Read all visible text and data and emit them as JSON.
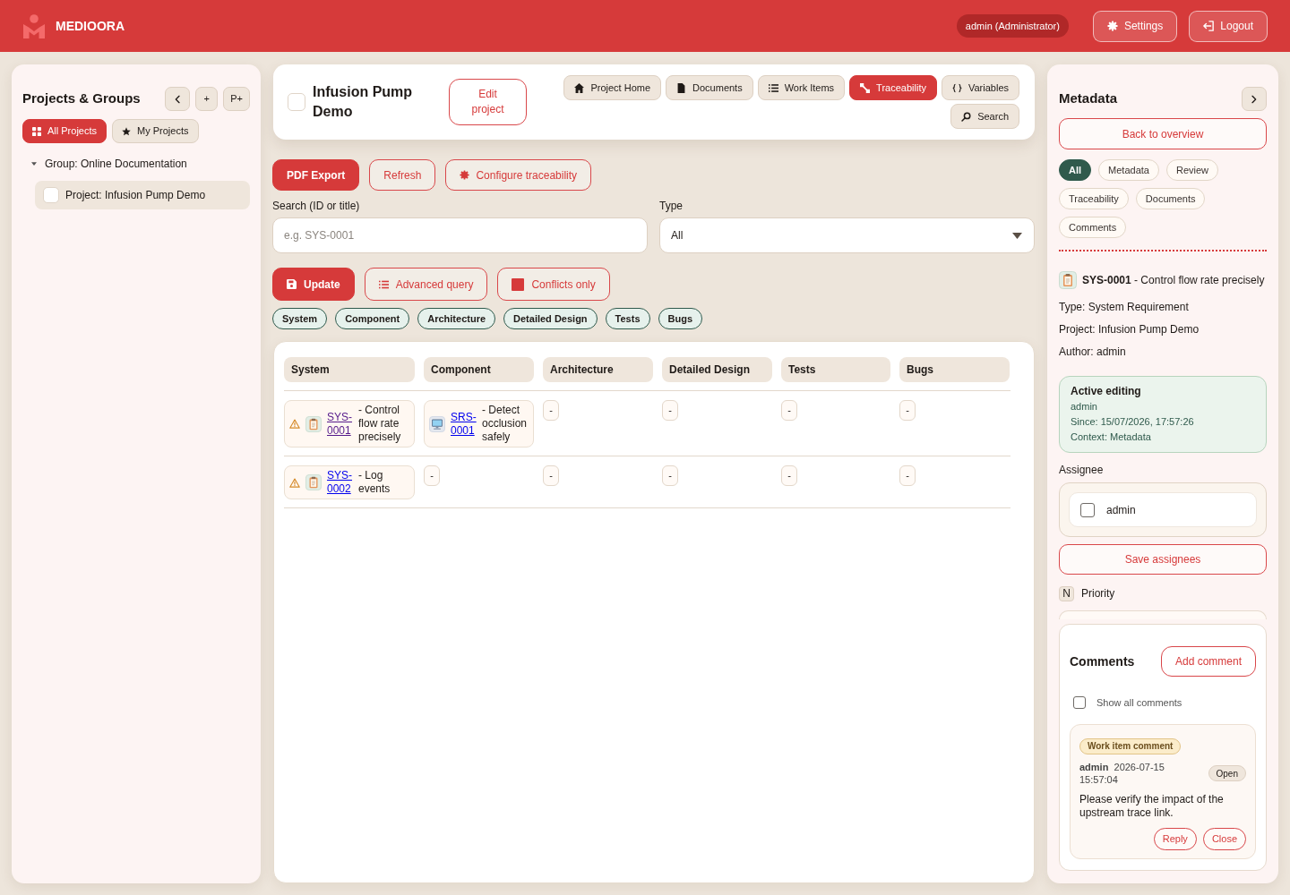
{
  "header": {
    "brand": "MEDIOORA",
    "user": "admin (Administrator)",
    "buttons": [
      "Settings",
      "Logout"
    ]
  },
  "sidebar": {
    "title": "Projects & Groups",
    "tool_buttons": [
      "+",
      "P+"
    ],
    "tabs": [
      {
        "label": "All Projects",
        "selected": true
      },
      {
        "label": "My Projects",
        "selected": false
      }
    ],
    "tree": [
      {
        "label": "Group: Online Documentation",
        "expanded": true,
        "children": [
          {
            "label": "Project: Infusion Pump Demo",
            "selected": true
          }
        ]
      }
    ]
  },
  "project": {
    "title": "Infusion Pump Demo",
    "edit_button": "Edit project",
    "nav": [
      {
        "label": "Project Home",
        "selected": false
      },
      {
        "label": "Documents",
        "selected": false
      },
      {
        "label": "Work Items",
        "selected": false
      },
      {
        "label": "Traceability",
        "selected": true
      },
      {
        "label": "Variables",
        "selected": false
      },
      {
        "label": "Search",
        "selected": false
      }
    ]
  },
  "actions": [
    {
      "label": "PDF Export",
      "kind": "primary"
    },
    {
      "label": "Refresh",
      "kind": "secondary"
    },
    {
      "label": "Configure traceability",
      "kind": "secondary"
    }
  ],
  "filters": {
    "search": {
      "label": "Search (ID or title)",
      "placeholder": "e.g. SYS-0001"
    },
    "type": {
      "label": "Type",
      "value": "All"
    }
  },
  "query_buttons": [
    {
      "label": "Update",
      "kind": "primary"
    },
    {
      "label": "Advanced query",
      "kind": "secondary"
    },
    {
      "label": "Conflicts only",
      "kind": "secondary"
    }
  ],
  "levels": [
    "System",
    "Component",
    "Architecture",
    "Detailed Design",
    "Tests",
    "Bugs"
  ],
  "table": {
    "columns": [
      "System",
      "Component",
      "Architecture",
      "Detailed Design",
      "Tests",
      "Bugs"
    ],
    "rows": [
      {
        "cells": [
          {
            "kind": "item",
            "warning": true,
            "id": "SYS-0001",
            "title": "- Control flow rate precisely",
            "visited": true
          },
          {
            "kind": "item",
            "warning": false,
            "id": "SRS-0001",
            "title": "- Detect occlusion safely",
            "visited": false
          },
          {
            "kind": "empty",
            "text": "-"
          },
          {
            "kind": "empty",
            "text": "-"
          },
          {
            "kind": "empty",
            "text": "-"
          },
          {
            "kind": "empty",
            "text": "-"
          }
        ]
      },
      {
        "cells": [
          {
            "kind": "item",
            "warning": true,
            "id": "SYS-0002",
            "title": "- Log events",
            "visited": false
          },
          {
            "kind": "empty",
            "text": "-"
          },
          {
            "kind": "empty",
            "text": "-"
          },
          {
            "kind": "empty",
            "text": "-"
          },
          {
            "kind": "empty",
            "text": "-"
          },
          {
            "kind": "empty",
            "text": "-"
          }
        ]
      }
    ]
  },
  "metadata_panel": {
    "title": "Metadata",
    "back_button": "Back to overview",
    "filters": [
      {
        "label": "All",
        "selected": true
      },
      {
        "label": "Metadata",
        "selected": false
      },
      {
        "label": "Review",
        "selected": false
      },
      {
        "label": "Traceability",
        "selected": false
      },
      {
        "label": "Documents",
        "selected": false
      },
      {
        "label": "Comments",
        "selected": false
      }
    ],
    "item": "**SYS-0001** - Control flow rate precisely",
    "details": [
      "Type: System Requirement",
      "Project: Infusion Pump Demo",
      "Author: admin"
    ],
    "active_editing": {
      "title": "Active editing",
      "lines": [
        "admin",
        "Since: 15/07/2026, 17:57:26",
        "Context: Metadata"
      ]
    },
    "assignee": {
      "label": "Assignee",
      "options": [
        {
          "label": "admin",
          "checked": false
        }
      ],
      "save_button": "Save assignees"
    },
    "priority": {
      "badge": "N",
      "label": "Priority"
    },
    "comments": {
      "title": "Comments",
      "add_button": "Add comment",
      "show_all": {
        "label": "Show all comments",
        "checked": false
      },
      "items": [
        {
          "tag": "Work item comment",
          "author": "admin",
          "time": "2026-07-15 15:57:04",
          "status": "Open",
          "text": "Please verify the impact of the upstream trace link.",
          "actions": [
            "Reply",
            "Close"
          ]
        }
      ]
    }
  }
}
